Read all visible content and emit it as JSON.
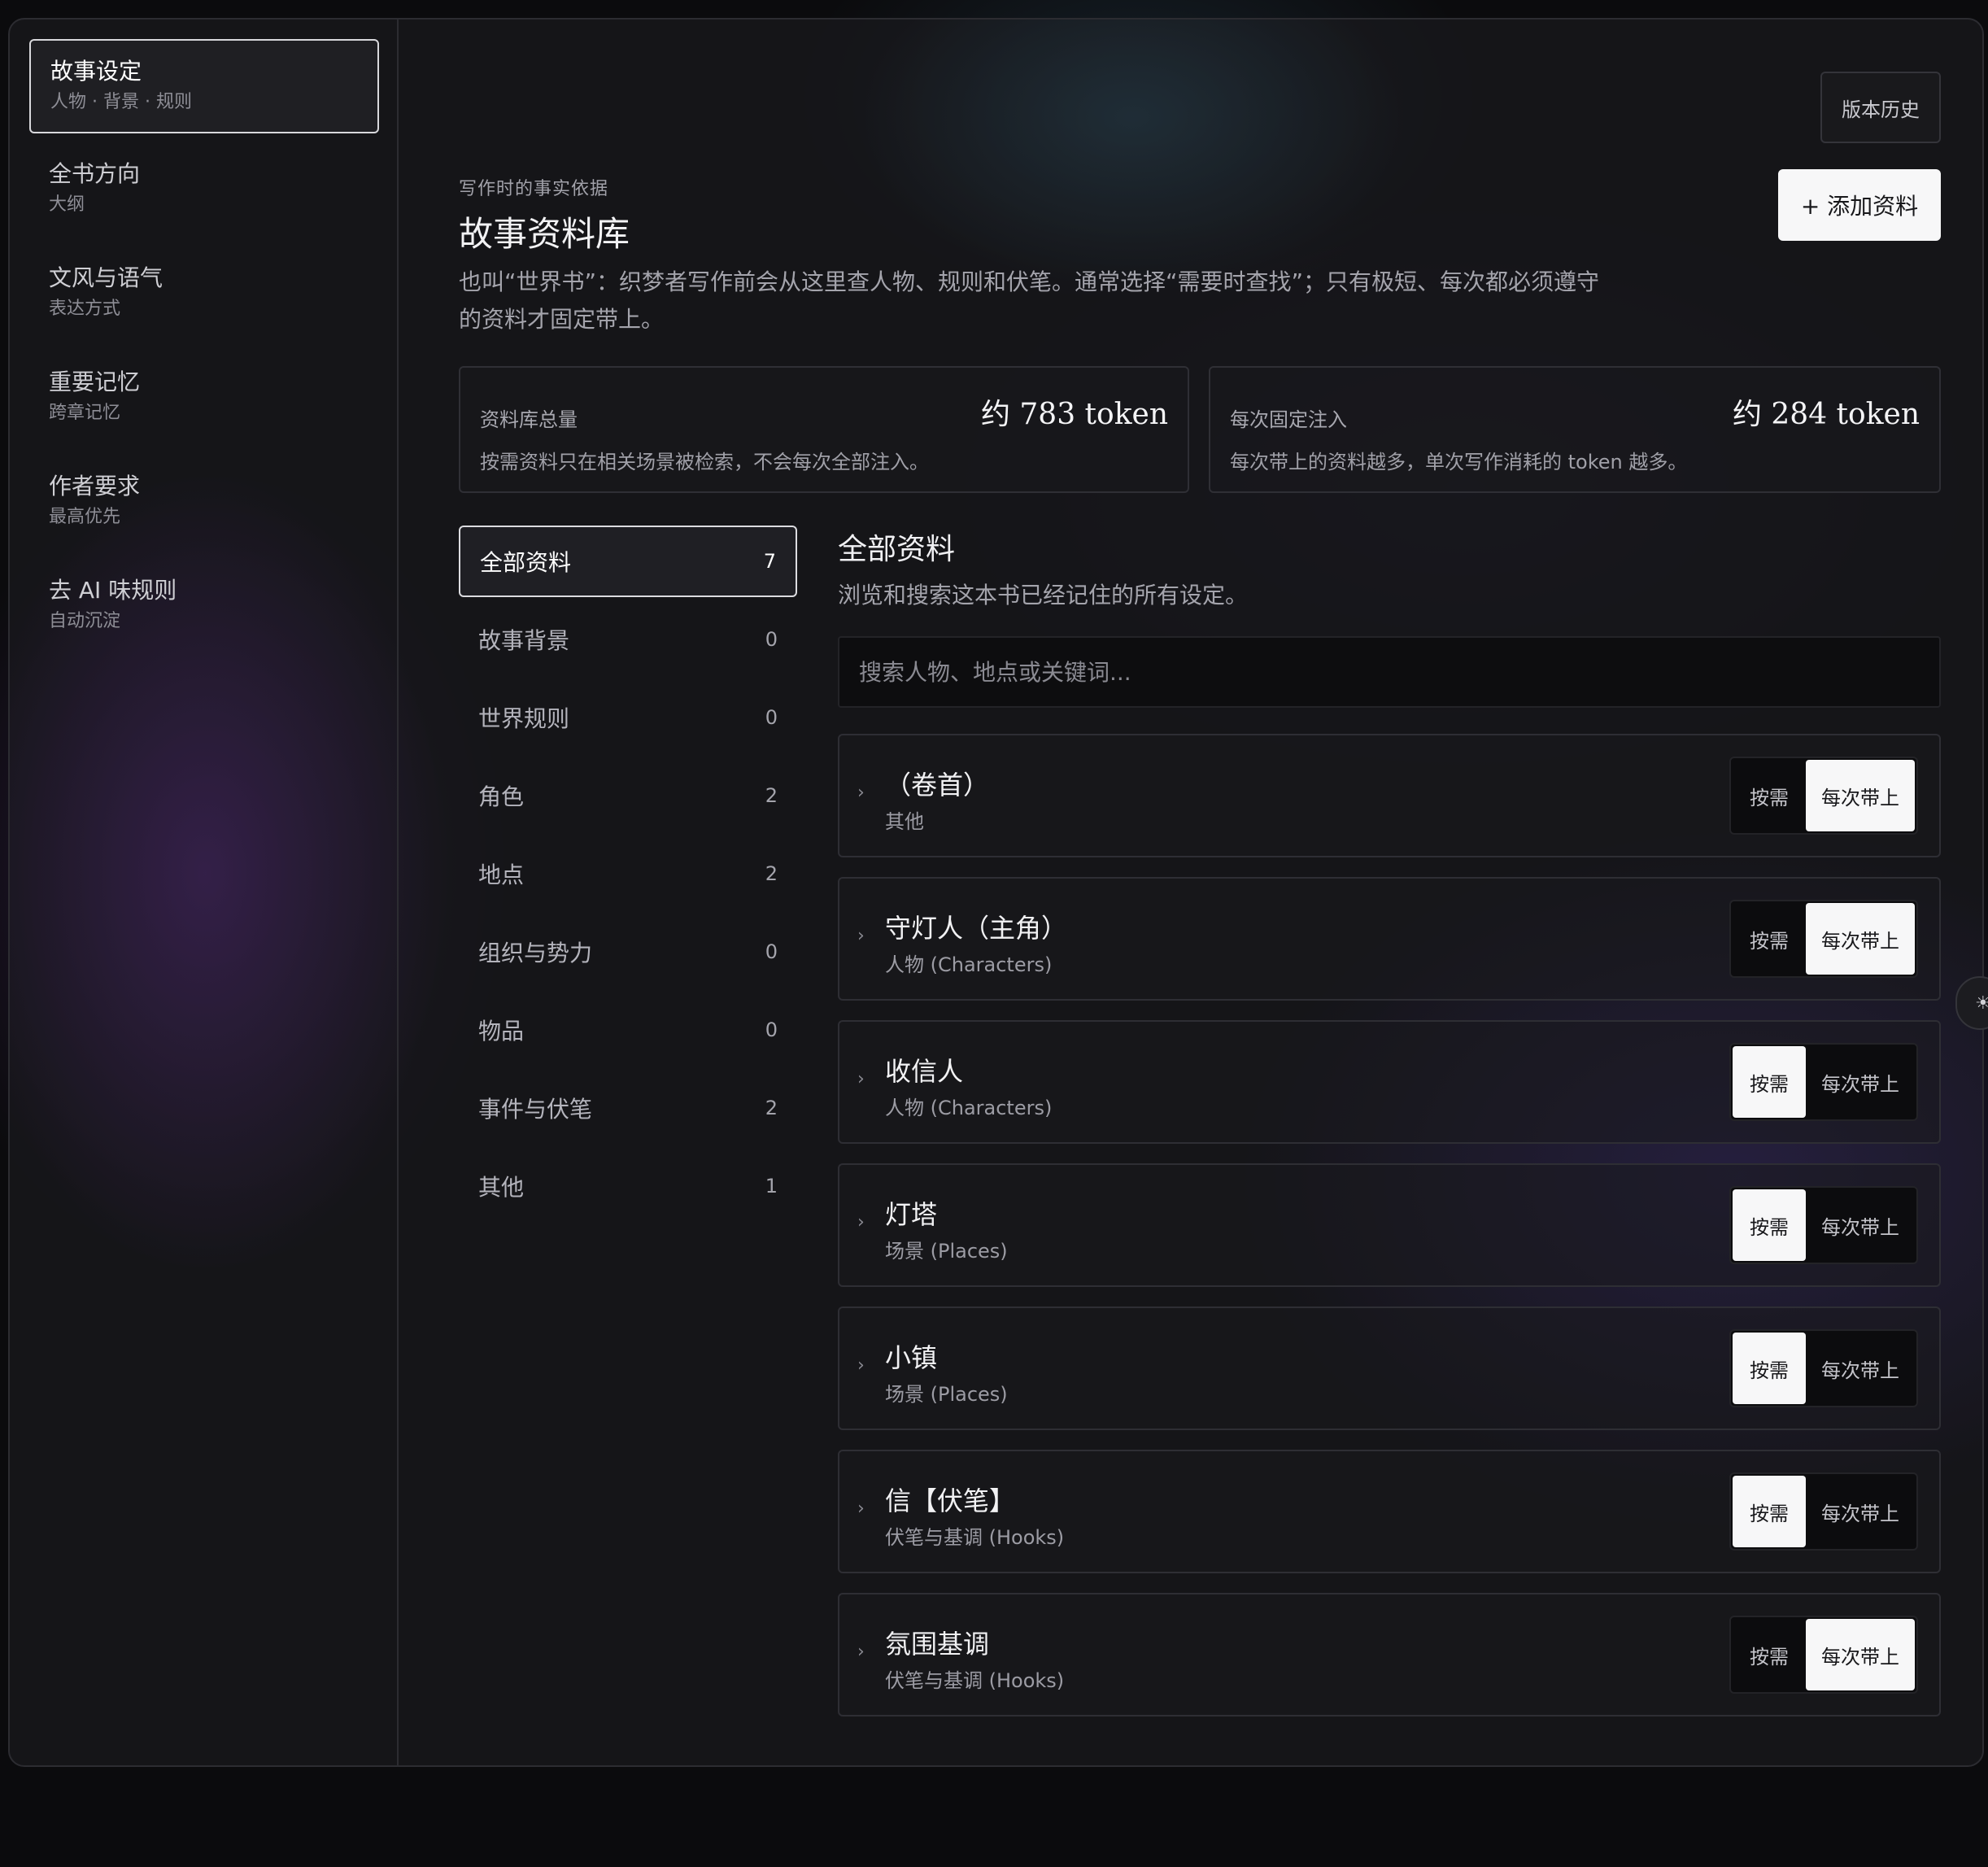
{
  "sidebar": {
    "items": [
      {
        "title": "故事设定",
        "sub": "人物 · 背景 · 规则",
        "active": true
      },
      {
        "title": "全书方向",
        "sub": "大纲",
        "active": false
      },
      {
        "title": "文风与语气",
        "sub": "表达方式",
        "active": false
      },
      {
        "title": "重要记忆",
        "sub": "跨章记忆",
        "active": false
      },
      {
        "title": "作者要求",
        "sub": "最高优先",
        "active": false
      },
      {
        "title": "去 AI 味规则",
        "sub": "自动沉淀",
        "active": false
      }
    ]
  },
  "header": {
    "history_button": "版本历史",
    "add_button": "+ 添加资料",
    "eyebrow": "写作时的事实依据",
    "title": "故事资料库",
    "description": "也叫“世界书”：织梦者写作前会从这里查人物、规则和伏笔。通常选择“需要时查找”；只有极短、每次都必须遵守的资料才固定带上。"
  },
  "stats": [
    {
      "label": "资料库总量",
      "value": "约 783 token",
      "note": "按需资料只在相关场景被检索，不会每次全部注入。"
    },
    {
      "label": "每次固定注入",
      "value": "约 284 token",
      "note": "每次带上的资料越多，单次写作消耗的 token 越多。"
    }
  ],
  "categories": [
    {
      "label": "全部资料",
      "count": "7",
      "active": true
    },
    {
      "label": "故事背景",
      "count": "0"
    },
    {
      "label": "世界规则",
      "count": "0"
    },
    {
      "label": "角色",
      "count": "2"
    },
    {
      "label": "地点",
      "count": "2"
    },
    {
      "label": "组织与势力",
      "count": "0"
    },
    {
      "label": "物品",
      "count": "0"
    },
    {
      "label": "事件与伏笔",
      "count": "2"
    },
    {
      "label": "其他",
      "count": "1"
    }
  ],
  "section": {
    "title": "全部资料",
    "description": "浏览和搜索这本书已经记住的所有设定。",
    "search_placeholder": "搜索人物、地点或关键词..."
  },
  "toggle_labels": {
    "on_demand": "按需",
    "always": "每次带上"
  },
  "entries": [
    {
      "title": "（卷首）",
      "type": "其他",
      "mode": "always"
    },
    {
      "title": "守灯人（主角）",
      "type": "人物 (Characters)",
      "mode": "always"
    },
    {
      "title": "收信人",
      "type": "人物 (Characters)",
      "mode": "on_demand"
    },
    {
      "title": "灯塔",
      "type": "场景 (Places)",
      "mode": "on_demand"
    },
    {
      "title": "小镇",
      "type": "场景 (Places)",
      "mode": "on_demand"
    },
    {
      "title": "信【伏笔】",
      "type": "伏笔与基调 (Hooks)",
      "mode": "on_demand"
    },
    {
      "title": "氛围基调",
      "type": "伏笔与基调 (Hooks)",
      "mode": "always"
    }
  ],
  "icons": {
    "chevron": "chevron-right-icon",
    "theme": "sun-icon"
  }
}
